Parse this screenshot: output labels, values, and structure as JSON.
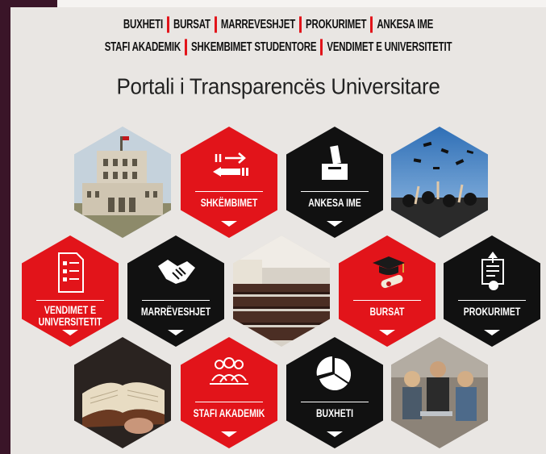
{
  "nav": {
    "row1": [
      "BUXHETI",
      "BURSAT",
      "MARREVESHJET",
      "PROKURIMET",
      "ANKESA IME"
    ],
    "row2": [
      "STAFI AKADEMIK",
      "SHKEMBIMET STUDENTORE",
      "VENDIMET E UNIVERSITETIT"
    ]
  },
  "title": "Portali i Transparencës Universitare",
  "tiles": {
    "shkembimet": "SHKËMBIMET",
    "ankesa": "ANKESA IME",
    "vendimet": "VENDIMET E\nUNIVERSITETIT",
    "marreveshjet": "MARRËVESHJET",
    "bursat": "BURSAT",
    "prokurimet": "PROKURIMET",
    "stafi": "STAFI AKADEMIK",
    "buxheti": "BUXHETI"
  },
  "colors": {
    "accent_red": "#e2141a",
    "tile_black": "#111111",
    "background": "#e9e6e3"
  }
}
